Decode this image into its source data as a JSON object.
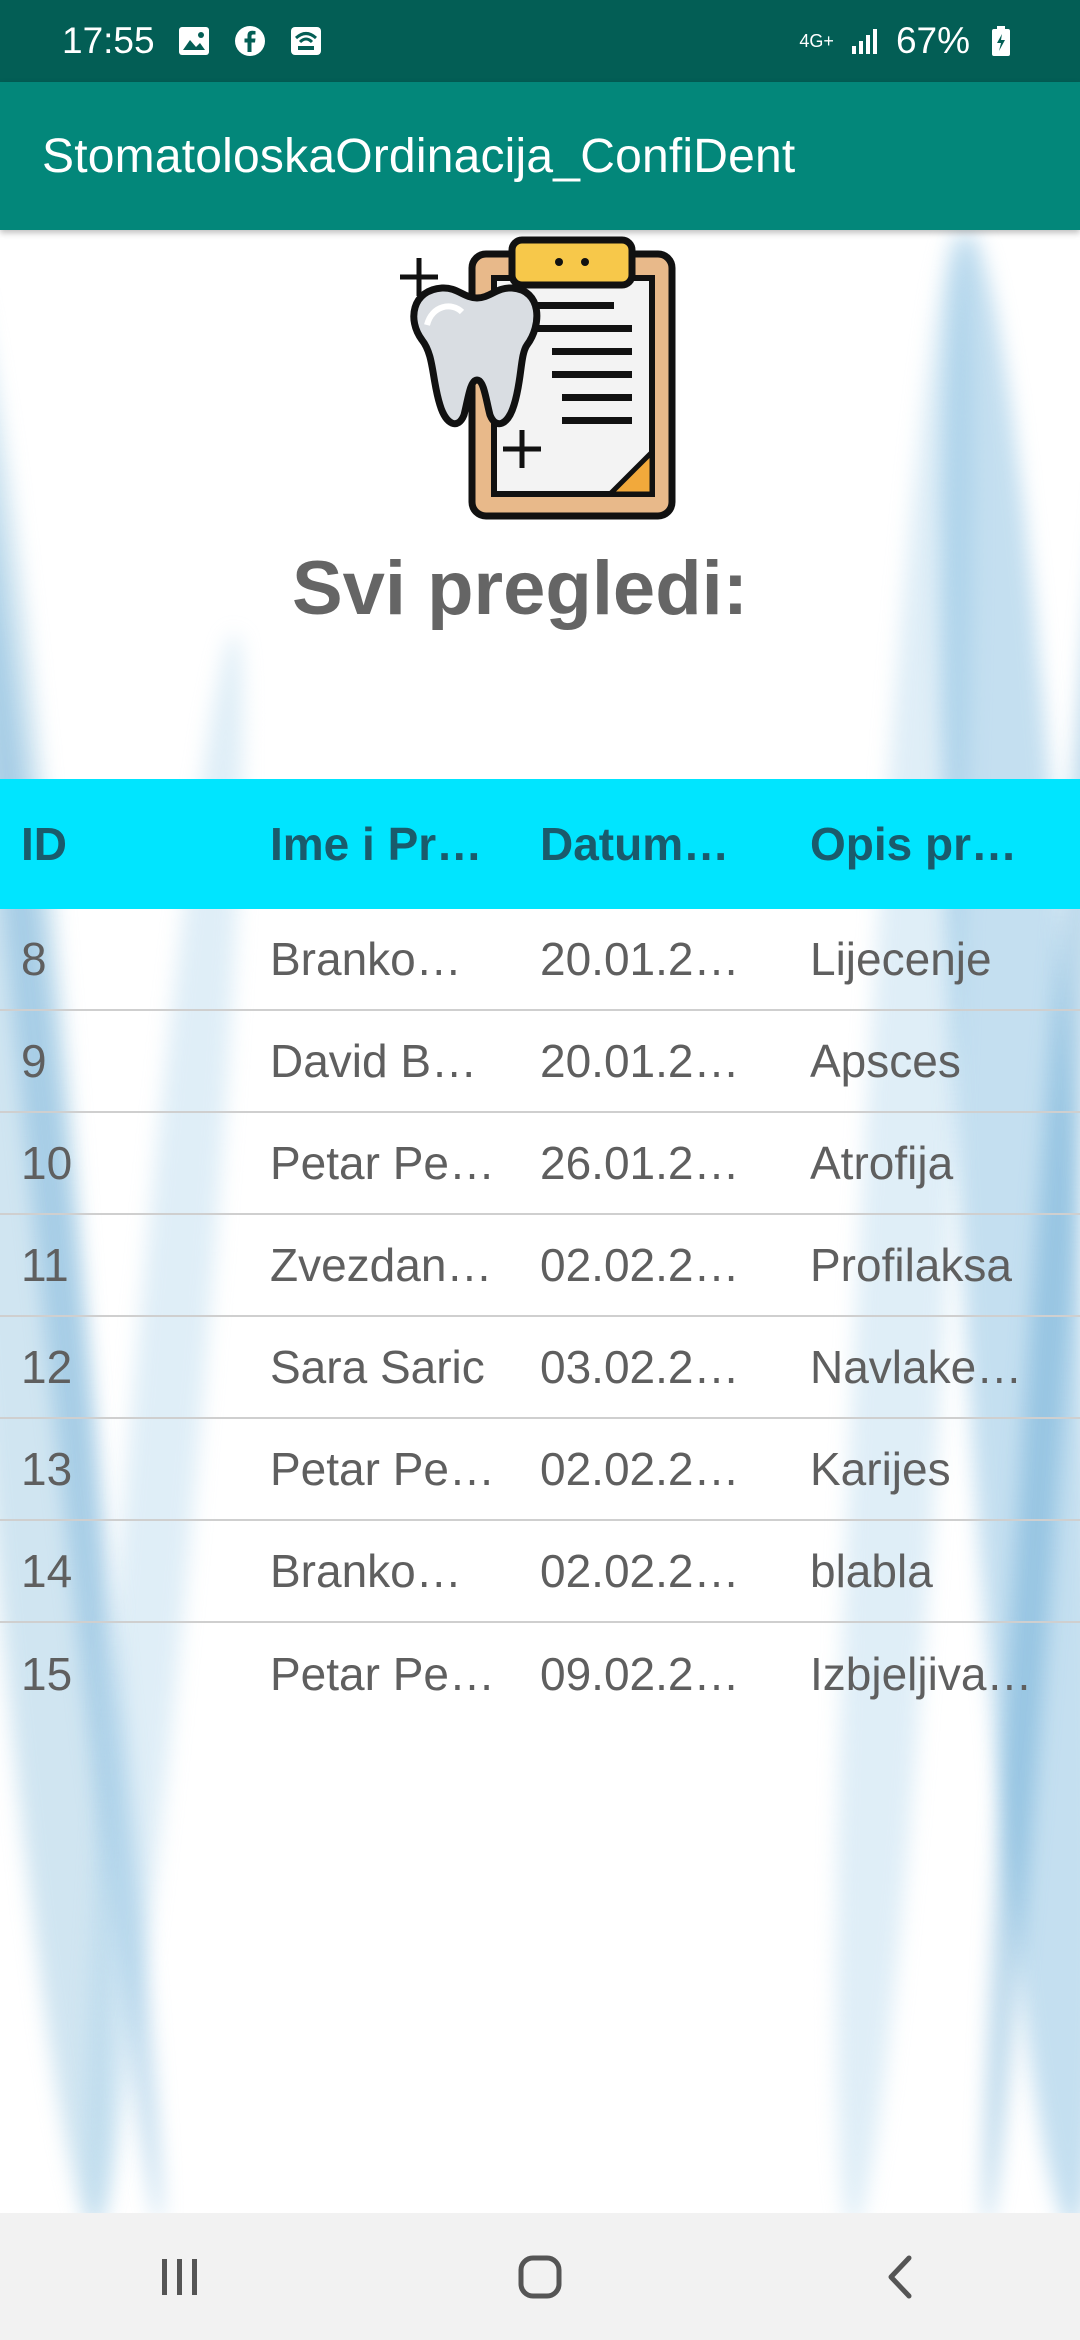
{
  "status_bar": {
    "time": "17:55",
    "network": "4G+",
    "battery": "67%",
    "icons": [
      "image-icon",
      "facebook-icon",
      "wifi-call-icon",
      "signal-icon",
      "battery-icon"
    ]
  },
  "app_bar": {
    "title": "StomatoloskaOrdinacija_ConfiDent"
  },
  "main": {
    "illustration": "tooth-clipboard-icon",
    "heading": "Svi pregledi:"
  },
  "table": {
    "columns": [
      "ID",
      "Ime i Pr…",
      "Datum…",
      "Opis pr…"
    ],
    "rows": [
      [
        "8",
        "Branko…",
        "20.01.2…",
        "Lijecenje"
      ],
      [
        "9",
        "David B…",
        "20.01.2…",
        "Apsces"
      ],
      [
        "10",
        "Petar Pe…",
        "26.01.2…",
        "Atrofija"
      ],
      [
        "11",
        "Zvezdan…",
        "02.02.2…",
        "Profilaksa"
      ],
      [
        "12",
        "Sara Saric",
        "03.02.2…",
        "Navlake…"
      ],
      [
        "13",
        "Petar Pe…",
        "02.02.2…",
        "Karijes"
      ],
      [
        "14",
        "Branko…",
        "02.02.2…",
        "blabla"
      ],
      [
        "15",
        "Petar Pe…",
        "09.02.2…",
        "Izbjeljiva…"
      ]
    ]
  },
  "nav_bar": {
    "buttons": [
      "recent-apps-icon",
      "home-icon",
      "back-icon"
    ]
  },
  "colors": {
    "status_bar": "#035e55",
    "app_bar": "#03877a",
    "table_header": "#00e5ff",
    "header_text": "#1a5b6c",
    "cell_text": "#5f5f5f"
  }
}
